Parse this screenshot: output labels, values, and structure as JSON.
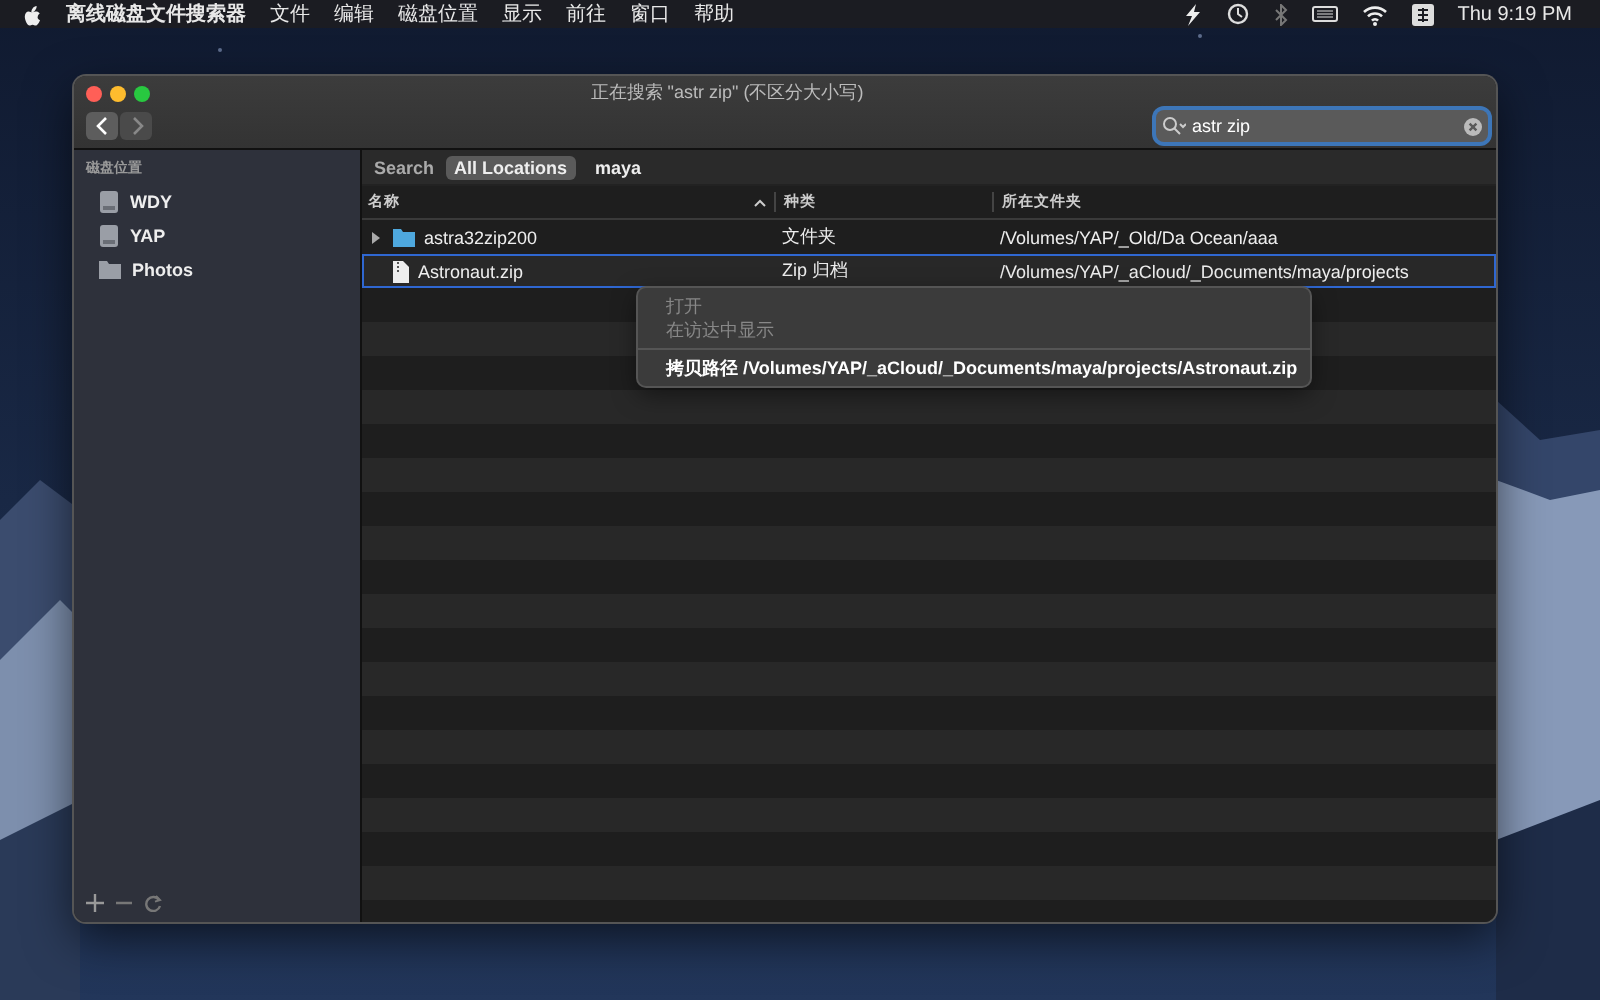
{
  "menubar": {
    "app": "离线磁盘文件搜索器",
    "menus": [
      "文件",
      "编辑",
      "磁盘位置",
      "显示",
      "前往",
      "窗口",
      "帮助"
    ],
    "clock": "Thu 9:19 PM"
  },
  "window": {
    "title": "正在搜索 \"astr zip\" (不区分大小写)",
    "search": {
      "value": "astr zip"
    }
  },
  "sidebar": {
    "heading": "磁盘位置",
    "items": [
      {
        "label": "WDY",
        "kind": "disk"
      },
      {
        "label": "YAP",
        "kind": "disk"
      },
      {
        "label": "Photos",
        "kind": "folder"
      }
    ]
  },
  "scope_bar": {
    "label": "Search",
    "scopes": [
      {
        "label": "All Locations",
        "selected": true
      },
      {
        "label": "maya",
        "selected": false
      }
    ]
  },
  "table": {
    "columns": [
      {
        "label": "名称",
        "sorted": true
      },
      {
        "label": "种类",
        "sorted": false
      },
      {
        "label": "所在文件夹",
        "sorted": false
      }
    ],
    "rows": [
      {
        "kind": "folder",
        "name": "astra32zip200",
        "type": "文件夹",
        "folder": "/Volumes/YAP/_Old/Da Ocean/aaa",
        "expanded": false,
        "selected": false
      },
      {
        "kind": "file",
        "name": "Astronaut.zip",
        "type": "Zip 归档",
        "folder": "/Volumes/YAP/_aCloud/_Documents/maya/projects",
        "selected": true
      }
    ]
  },
  "context_menu": {
    "items": [
      {
        "kind": "item",
        "label": "打开",
        "disabled": true
      },
      {
        "kind": "item",
        "label": "在访达中显示",
        "disabled": true
      },
      {
        "kind": "separator"
      },
      {
        "kind": "item",
        "label": "拷贝路径 /Volumes/YAP/_aCloud/_Documents/maya/projects/Astronaut.zip",
        "disabled": false
      }
    ]
  }
}
